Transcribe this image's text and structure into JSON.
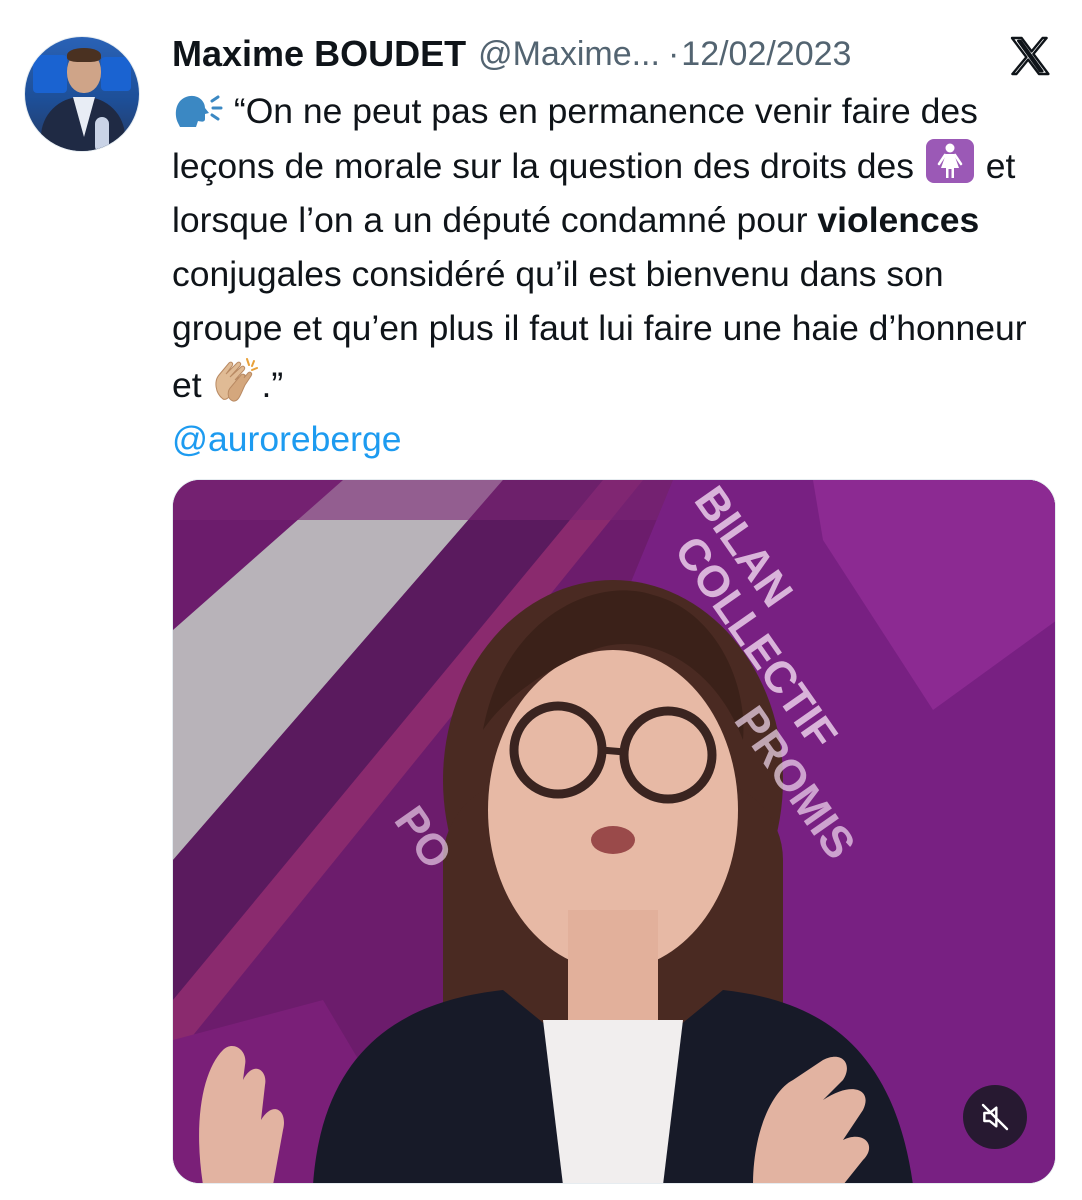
{
  "tweet": {
    "author_name": "Maxime BOUDET",
    "author_handle": "@Maxime...",
    "separator": "·",
    "date": "12/02/2023",
    "text": {
      "part1": "“On ne peut pas en permanence venir faire des leçons de morale sur la question des droits des",
      "part2": "et lorsque l’on a un député condamné pour",
      "bold_word": "violences",
      "part3": "conjugales considéré qu’il est bienvenu dans son groupe et qu’en plus il faut lui faire une haie d’honneur et",
      "part4": ".”"
    },
    "mention": "@auroreberge",
    "icons": {
      "speaking_head": "speaking-head-icon",
      "woman_symbol": "woman-icon",
      "clapping_hands": "clapping-hands-icon",
      "platform_logo": "x-logo-icon",
      "mute": "muted-speaker-icon"
    },
    "colors": {
      "text": "#0f1419",
      "secondary": "#536471",
      "link": "#1d9bf0",
      "woman_emoji_bg": "#9b59b6",
      "studio_backdrop": "#6f1f6f"
    }
  }
}
